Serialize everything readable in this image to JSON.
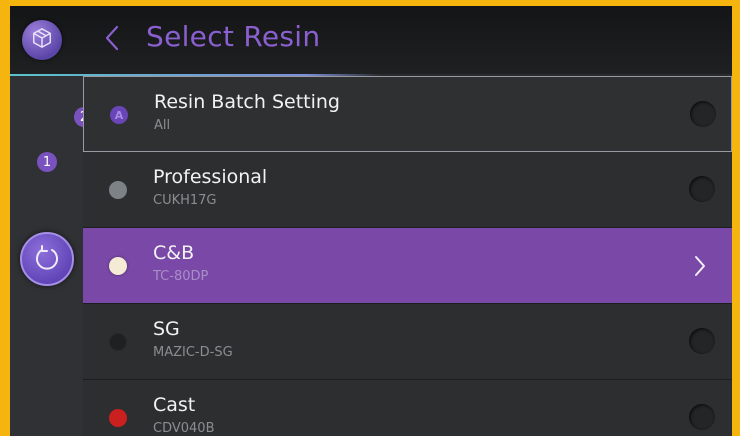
{
  "header": {
    "title": "Select Resin",
    "back_icon": "chevron-left-icon",
    "logo_icon": "cube-icon"
  },
  "rail": {
    "reset_icon": "undo-rotate-icon",
    "reset_badge": "1",
    "list_badge": "2"
  },
  "resins": [
    {
      "name": "Resin Batch Setting",
      "code": "All",
      "dot_color": "#6a45b8",
      "dot_letter": "A",
      "state": "focused"
    },
    {
      "name": "Professional",
      "code": "CUKH17G",
      "dot_color": "#7d8287",
      "state": "normal"
    },
    {
      "name": "C&B",
      "code": "TC-80DP",
      "dot_color": "#f4ead6",
      "state": "selected"
    },
    {
      "name": "SG",
      "code": "MAZIC-D-SG",
      "dot_color": "#1f2022",
      "state": "normal"
    },
    {
      "name": "Cast",
      "code": "CDV040B",
      "dot_color": "#cc1f1f",
      "state": "normal"
    }
  ],
  "colors": {
    "frame": "#f5b50e",
    "accent": "#8a5fcf",
    "selected_row": "#7a49a8"
  }
}
